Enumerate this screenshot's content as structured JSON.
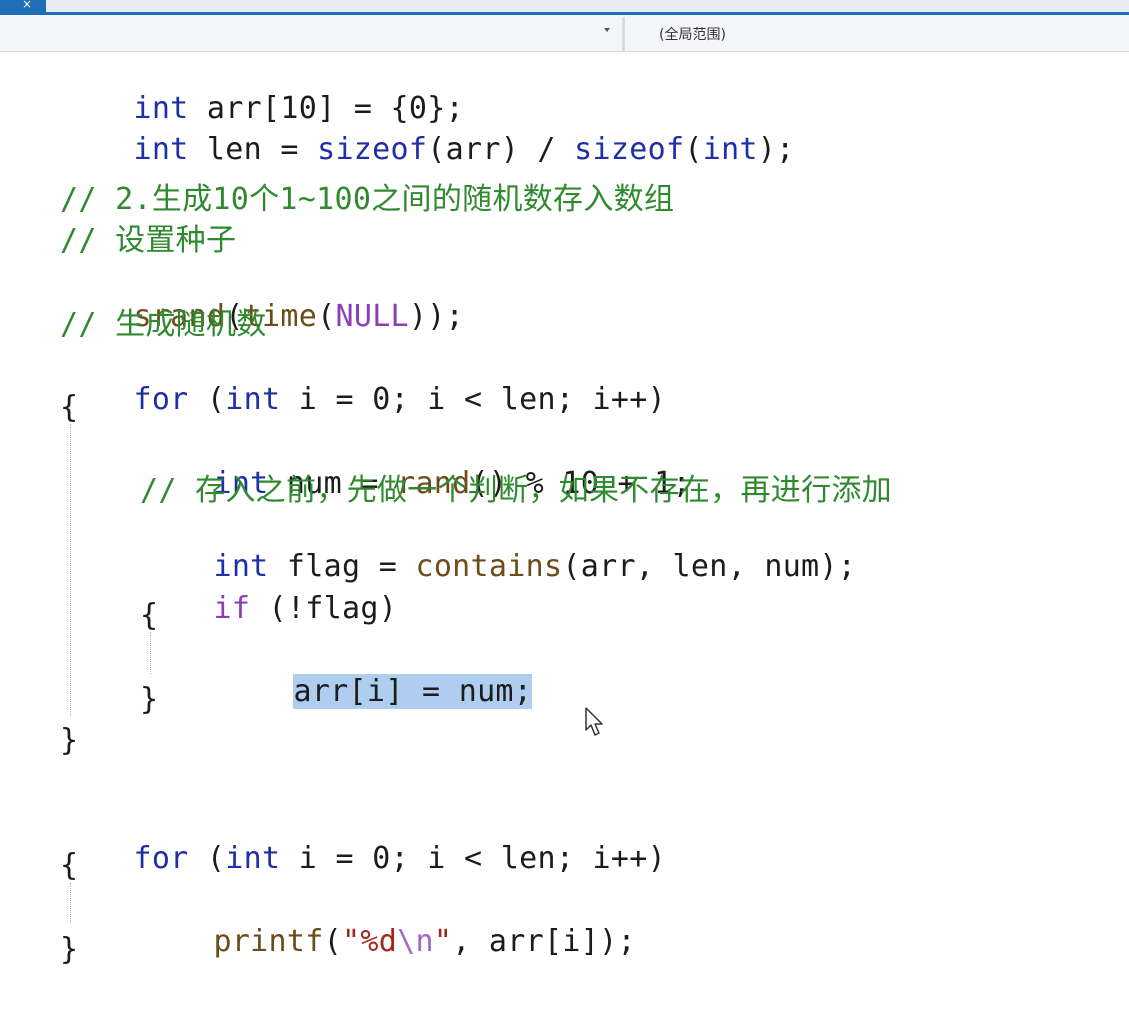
{
  "window": {
    "tab_close_glyph": "×",
    "scope_dropdown_label": "(全局范围)"
  },
  "code": {
    "l1": [
      "int",
      " arr[",
      "10",
      "] = {",
      "0",
      "};"
    ],
    "l2": [
      "int",
      " len = ",
      "sizeof",
      "(arr) / ",
      "sizeof",
      "(",
      "int",
      ");"
    ],
    "l4": "// 2.生成10个1~100之间的随机数存入数组",
    "l5": "// 设置种子",
    "l6": [
      "srand",
      "(",
      "time",
      "(",
      "NULL",
      "));"
    ],
    "l7": "// 生成随机数",
    "l8": [
      "for",
      " (",
      "int",
      " i = ",
      "0",
      "; i < len; i++)"
    ],
    "l9": "{",
    "l10": [
      "int",
      " num = ",
      "rand",
      "() % ",
      "10",
      " + ",
      "1",
      ";"
    ],
    "l11": "// 存入之前，先做一个判断，如果不存在，再进行添加",
    "l12": [
      "int",
      " flag = ",
      "contains",
      "(arr, len, num);"
    ],
    "l13": [
      "if",
      " (!flag)"
    ],
    "l14": "{",
    "l15": "arr[i] = num;",
    "l16": "}",
    "l17": "}",
    "l19": [
      "for",
      " (",
      "int",
      " i = ",
      "0",
      "; i < len; i++)"
    ],
    "l20": "{",
    "l21": [
      "printf",
      "(",
      "\"%d",
      "\\n",
      "\"",
      ", arr[i]);"
    ],
    "l22": "}"
  },
  "colors": {
    "keyword": "#1e2fa8",
    "function": "#6b4d1a",
    "macro": "#8a3fb8",
    "string": "#a1261b",
    "escape": "#a36ac7",
    "comment": "#2f8a2f",
    "selection": "#aecdef",
    "accent": "#1e6fb8"
  },
  "icons": {
    "tab_close": "close-icon",
    "dropdown": "chevron-down-icon",
    "pointer": "mouse-cursor-icon"
  }
}
